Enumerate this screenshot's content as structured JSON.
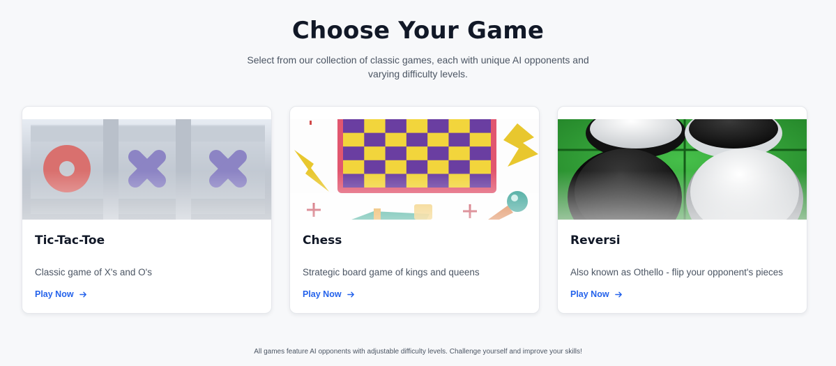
{
  "header": {
    "title": "Choose Your Game",
    "subtitle": "Select from our collection of classic games, each with unique AI opponents and varying difficulty levels."
  },
  "games": [
    {
      "title": "Tic-Tac-Toe",
      "description": "Classic game of X's and O's",
      "cta": "Play Now",
      "image_icon": "tic-tac-toe-board-icon"
    },
    {
      "title": "Chess",
      "description": "Strategic board game of kings and queens",
      "cta": "Play Now",
      "image_icon": "chessboard-icon"
    },
    {
      "title": "Reversi",
      "description": "Also known as Othello - flip your opponent's pieces",
      "cta": "Play Now",
      "image_icon": "reversi-discs-icon"
    }
  ],
  "footer": {
    "text": "All games feature AI opponents with adjustable difficulty levels. Challenge yourself and improve your skills!"
  },
  "colors": {
    "accent": "#2563eb",
    "background": "#f7f8fa",
    "heading": "#111827"
  }
}
